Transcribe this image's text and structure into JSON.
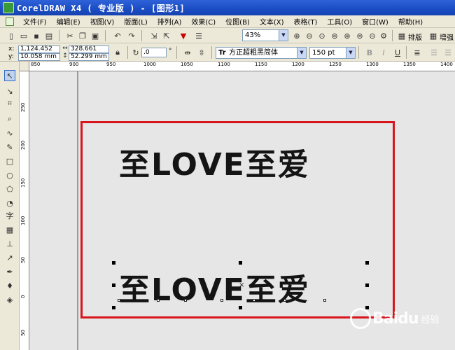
{
  "window": {
    "title": "CorelDRAW X4 ( 专业版 ) - [图形1]"
  },
  "menu": [
    "文件(F)",
    "编辑(E)",
    "视图(V)",
    "版面(L)",
    "排列(A)",
    "效果(C)",
    "位图(B)",
    "文本(X)",
    "表格(T)",
    "工具(O)",
    "窗口(W)",
    "帮助(H)"
  ],
  "toolbar": {
    "zoom": "43%",
    "layout_label": "排版",
    "enhance_label": "增强"
  },
  "properties": {
    "x_value": "1,124.452 mm",
    "y_value": "10.058 mm",
    "width_value": "328.661 mm",
    "height_value": "52.299 mm",
    "rotation_value": ".0",
    "font_name": "方正超粗黑简体",
    "font_size": "150 pt"
  },
  "ruler": {
    "h_ticks": [
      "850",
      "900",
      "950",
      "1000",
      "1050",
      "1100",
      "1150",
      "1200",
      "1250",
      "1300",
      "1350",
      "1400"
    ],
    "v_ticks": [
      "250",
      "200",
      "150",
      "100",
      "50",
      "0",
      "50"
    ]
  },
  "canvas": {
    "text_top": "至LOVE至爱",
    "text_bottom": "至LOVE至爱",
    "center_mark": "×",
    "frame_color": "#d8141c"
  },
  "watermark": {
    "brand": "Bai",
    "suffix": "du",
    "sub": "经验"
  }
}
